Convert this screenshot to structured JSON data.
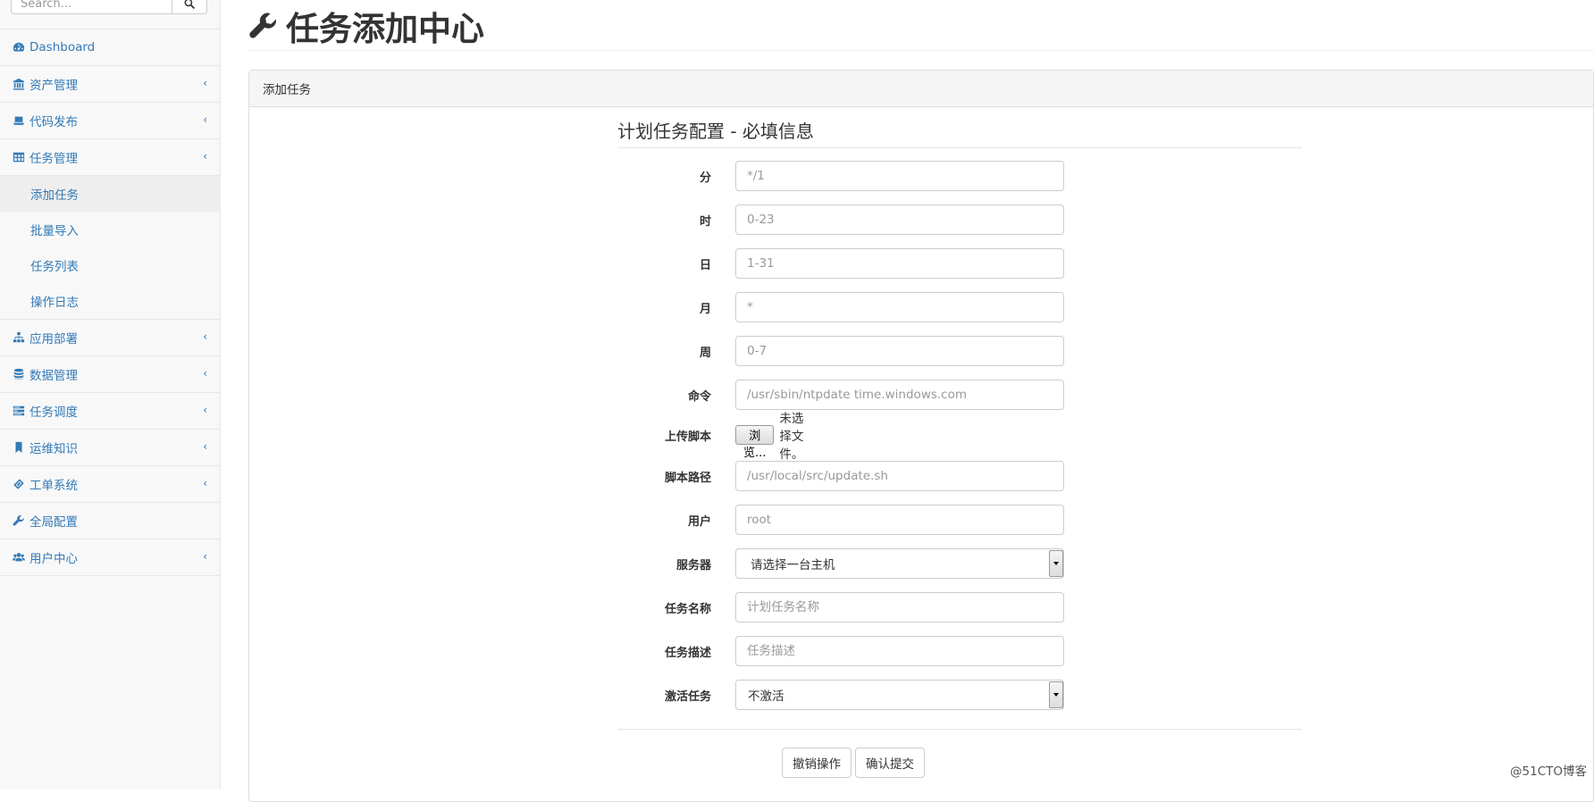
{
  "search": {
    "placeholder": "Search..."
  },
  "sidebar": {
    "items": [
      {
        "label": "Dashboard",
        "icon": "dashboard-icon",
        "has_children": false
      },
      {
        "label": "资产管理",
        "icon": "bank-icon",
        "has_children": true
      },
      {
        "label": "代码发布",
        "icon": "laptop-icon",
        "has_children": true
      },
      {
        "label": "任务管理",
        "icon": "table-icon",
        "has_children": true,
        "expanded": true,
        "children": [
          {
            "label": "添加任务",
            "active": true
          },
          {
            "label": "批量导入"
          },
          {
            "label": "任务列表"
          },
          {
            "label": "操作日志"
          }
        ]
      },
      {
        "label": "应用部署",
        "icon": "sitemap-icon",
        "has_children": true
      },
      {
        "label": "数据管理",
        "icon": "database-icon",
        "has_children": true
      },
      {
        "label": "任务调度",
        "icon": "tasks-icon",
        "has_children": true
      },
      {
        "label": "运维知识",
        "icon": "bookmark-icon",
        "has_children": true
      },
      {
        "label": "工单系统",
        "icon": "ticket-icon",
        "has_children": true
      },
      {
        "label": "全局配置",
        "icon": "wrench-icon",
        "has_children": false
      },
      {
        "label": "用户中心",
        "icon": "users-icon",
        "has_children": true
      }
    ],
    "chevron": "‹"
  },
  "page": {
    "title": "任务添加中心",
    "icon": "wrench-icon"
  },
  "panel": {
    "heading": "添加任务"
  },
  "form": {
    "legend": "计划任务配置 - 必填信息",
    "fields": {
      "minute": {
        "label": "分",
        "placeholder": "*/1"
      },
      "hour": {
        "label": "时",
        "placeholder": "0-23"
      },
      "day": {
        "label": "日",
        "placeholder": "1-31"
      },
      "month": {
        "label": "月",
        "placeholder": "*"
      },
      "week": {
        "label": "周",
        "placeholder": "0-7"
      },
      "command": {
        "label": "命令",
        "placeholder": "/usr/sbin/ntpdate time.windows.com"
      },
      "upload": {
        "label": "上传脚本",
        "button": "浏览...",
        "status": "未选择文件。"
      },
      "script_path": {
        "label": "脚本路径",
        "placeholder": "/usr/local/src/update.sh"
      },
      "user": {
        "label": "用户",
        "placeholder": "root"
      },
      "server": {
        "label": "服务器",
        "value": "请选择一台主机"
      },
      "task_name": {
        "label": "任务名称",
        "placeholder": "计划任务名称"
      },
      "task_desc": {
        "label": "任务描述",
        "placeholder": "任务描述"
      },
      "activate": {
        "label": "激活任务",
        "value": "不激活"
      }
    },
    "buttons": {
      "cancel": "撤销操作",
      "submit": "确认提交"
    }
  },
  "watermark": "@51CTO博客",
  "colors": {
    "link": "#337ab7",
    "sidebar_bg": "#f8f8f8",
    "active_bg": "#eeeeee"
  }
}
